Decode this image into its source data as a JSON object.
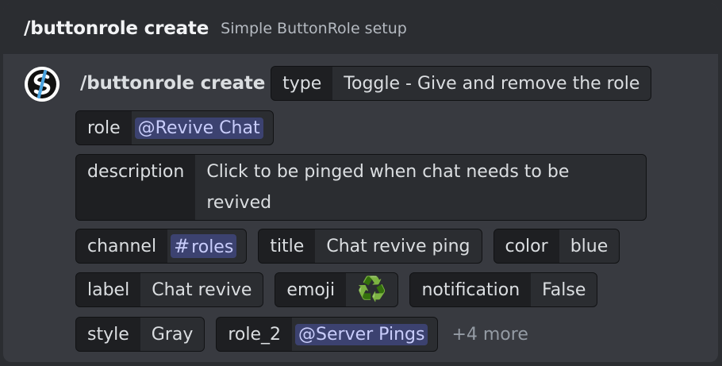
{
  "header": {
    "command": "/buttonrole create",
    "description": "Simple ButtonRole setup"
  },
  "message": {
    "command": "/buttonrole create",
    "options": {
      "type": {
        "key": "type",
        "value": "Toggle - Give and remove the role"
      },
      "role": {
        "key": "role",
        "value": "@Revive Chat"
      },
      "description": {
        "key": "description",
        "value": "Click to be pinged when chat needs to be revived"
      },
      "channel": {
        "key": "channel",
        "hash": "#",
        "value": "roles"
      },
      "title": {
        "key": "title",
        "value": "Chat revive ping"
      },
      "color": {
        "key": "color",
        "value": "blue"
      },
      "label": {
        "key": "label",
        "value": "Chat revive"
      },
      "emoji": {
        "key": "emoji",
        "value": "♻️"
      },
      "notification": {
        "key": "notification",
        "value": "False"
      },
      "style": {
        "key": "style",
        "value": "Gray"
      },
      "role_2": {
        "key": "role_2",
        "value": "@Server Pings"
      }
    },
    "more": "+4 more"
  },
  "icons": {
    "avatar": "bot-avatar-icon",
    "emoji": "recycle-icon"
  },
  "colors": {
    "background": "#383a40",
    "header": "#2b2d31",
    "chip_key": "#1e1f22",
    "chip_value": "#2b2d31",
    "mention_bg": "#3c4270",
    "mention_fg": "#c9cdfb"
  }
}
